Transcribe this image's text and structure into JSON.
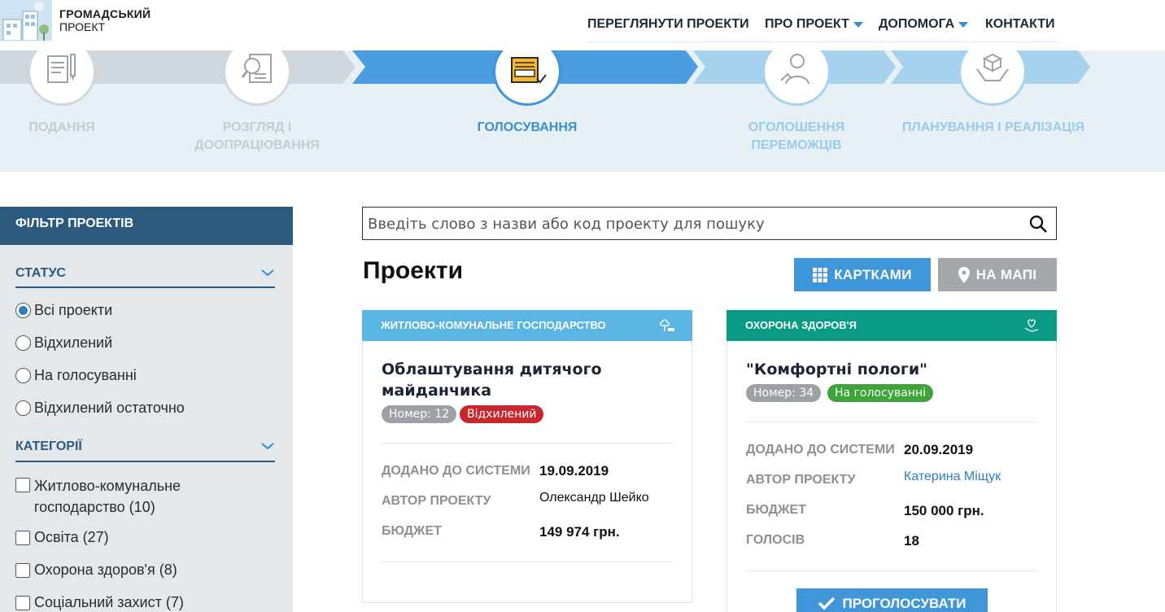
{
  "brand": {
    "title": "ГРОМАДСЬКИЙ",
    "subtitle": "ПРОЕКТ"
  },
  "nav": {
    "items": [
      {
        "label": "ПЕРЕГЛЯНУТИ ПРОЕКТИ",
        "has_dropdown": false
      },
      {
        "label": "ПРО ПРОЕКТ",
        "has_dropdown": true
      },
      {
        "label": "ДОПОМОГА",
        "has_dropdown": true
      },
      {
        "label": "КОНТАКТИ",
        "has_dropdown": false
      }
    ]
  },
  "stages": [
    {
      "label_line1": "ПОДАННЯ",
      "label_line2": "",
      "state": "completed",
      "icon": "document-pen-icon"
    },
    {
      "label_line1": "РОЗГЛЯД І",
      "label_line2": "ДООПРАЦЮВАННЯ",
      "state": "completed",
      "icon": "review-magnifier-icon"
    },
    {
      "label_line1": "ГОЛОСУВАННЯ",
      "label_line2": "",
      "state": "active",
      "icon": "ballot-icon"
    },
    {
      "label_line1": "ОГОЛОШЕННЯ",
      "label_line2": "ПЕРЕМОЖЦІВ",
      "state": "upcoming",
      "icon": "winner-icon"
    },
    {
      "label_line1": "ПЛАНУВАННЯ І РЕАЛІЗАЦІЯ",
      "label_line2": "",
      "state": "upcoming",
      "icon": "hands-box-icon"
    }
  ],
  "filter": {
    "title": "ФІЛЬТР ПРОЕКТІВ",
    "status": {
      "title": "СТАТУС",
      "options": [
        {
          "label": "Всі проекти",
          "selected": true
        },
        {
          "label": "Відхилений",
          "selected": false
        },
        {
          "label": "На голосуванні",
          "selected": false
        },
        {
          "label": "Відхилений остаточно",
          "selected": false
        }
      ]
    },
    "categories": {
      "title": "КАТЕГОРІЇ",
      "options": [
        {
          "line1": "Житлово-комунальне",
          "line2": "господарство (10)",
          "checked": false
        },
        {
          "line1": "Освіта (27)",
          "line2": "",
          "checked": false
        },
        {
          "line1": "Охорона здоров'я (8)",
          "line2": "",
          "checked": false
        },
        {
          "line1": "Соціальний захист (7)",
          "line2": "",
          "checked": false
        }
      ]
    }
  },
  "search": {
    "placeholder": "Введіть слово з назви або код проекту для пошуку"
  },
  "main": {
    "title": "Проекти",
    "view_cards_label": "КАРТКАМИ",
    "view_map_label": "НА МАПІ"
  },
  "projects": [
    {
      "category": "ЖИТЛОВО-КОМУНАЛЬНЕ ГОСПОДАРСТВО",
      "category_color": "#5bb5e2",
      "title_line1": "Облаштування дитячого",
      "title_line2": "майданчика",
      "number_label": "Номер: 12",
      "status_label": "Відхилений",
      "status_color": "#c8282d",
      "added_label": "ДОДАНО ДО СИСТЕМИ",
      "added_value": "19.09.2019",
      "author_label": "АВТОР ПРОЕКТУ",
      "author_value": "Олександр Шейко",
      "budget_label": "БЮДЖЕТ",
      "budget_value": "149 974 грн."
    },
    {
      "category": "ОХОРОНА ЗДОРОВ'Я",
      "category_color": "#0a9a86",
      "title_line1": "\"Комфортні пологи\"",
      "title_line2": "",
      "number_label": "Номер: 34",
      "status_label": "На голосуванні",
      "status_color": "#3da33a",
      "added_label": "ДОДАНО ДО СИСТЕМИ",
      "added_value": "20.09.2019",
      "author_label": "АВТОР ПРОЕКТУ",
      "author_value": "Катерина Міщук",
      "budget_label": "БЮДЖЕТ",
      "budget_value": "150 000 грн.",
      "votes_label": "ГОЛОСІВ",
      "votes_value": "18",
      "vote_button_label": "ПРОГОЛОСУВАТИ"
    }
  ]
}
